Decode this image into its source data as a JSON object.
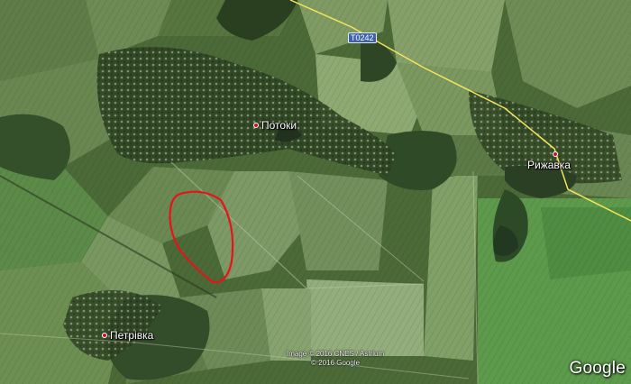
{
  "map": {
    "imagery": "satellite",
    "places": [
      {
        "id": "potoky",
        "label": "Потоки"
      },
      {
        "id": "ryzhavka",
        "label": "Рижавка"
      },
      {
        "id": "petrivka",
        "label": "Петрівка"
      }
    ],
    "road_label": "T0242",
    "attribution_line1": "Image © 2016 CNES / Astrium",
    "attribution_line2": "© 2016 Google",
    "logo": "Google",
    "colors": {
      "highlight": "#e8131a",
      "road": "#f5e35a",
      "pin": "#c8102e",
      "shield": "#3c64a8"
    },
    "icons": [
      "place-pin-icon"
    ]
  }
}
